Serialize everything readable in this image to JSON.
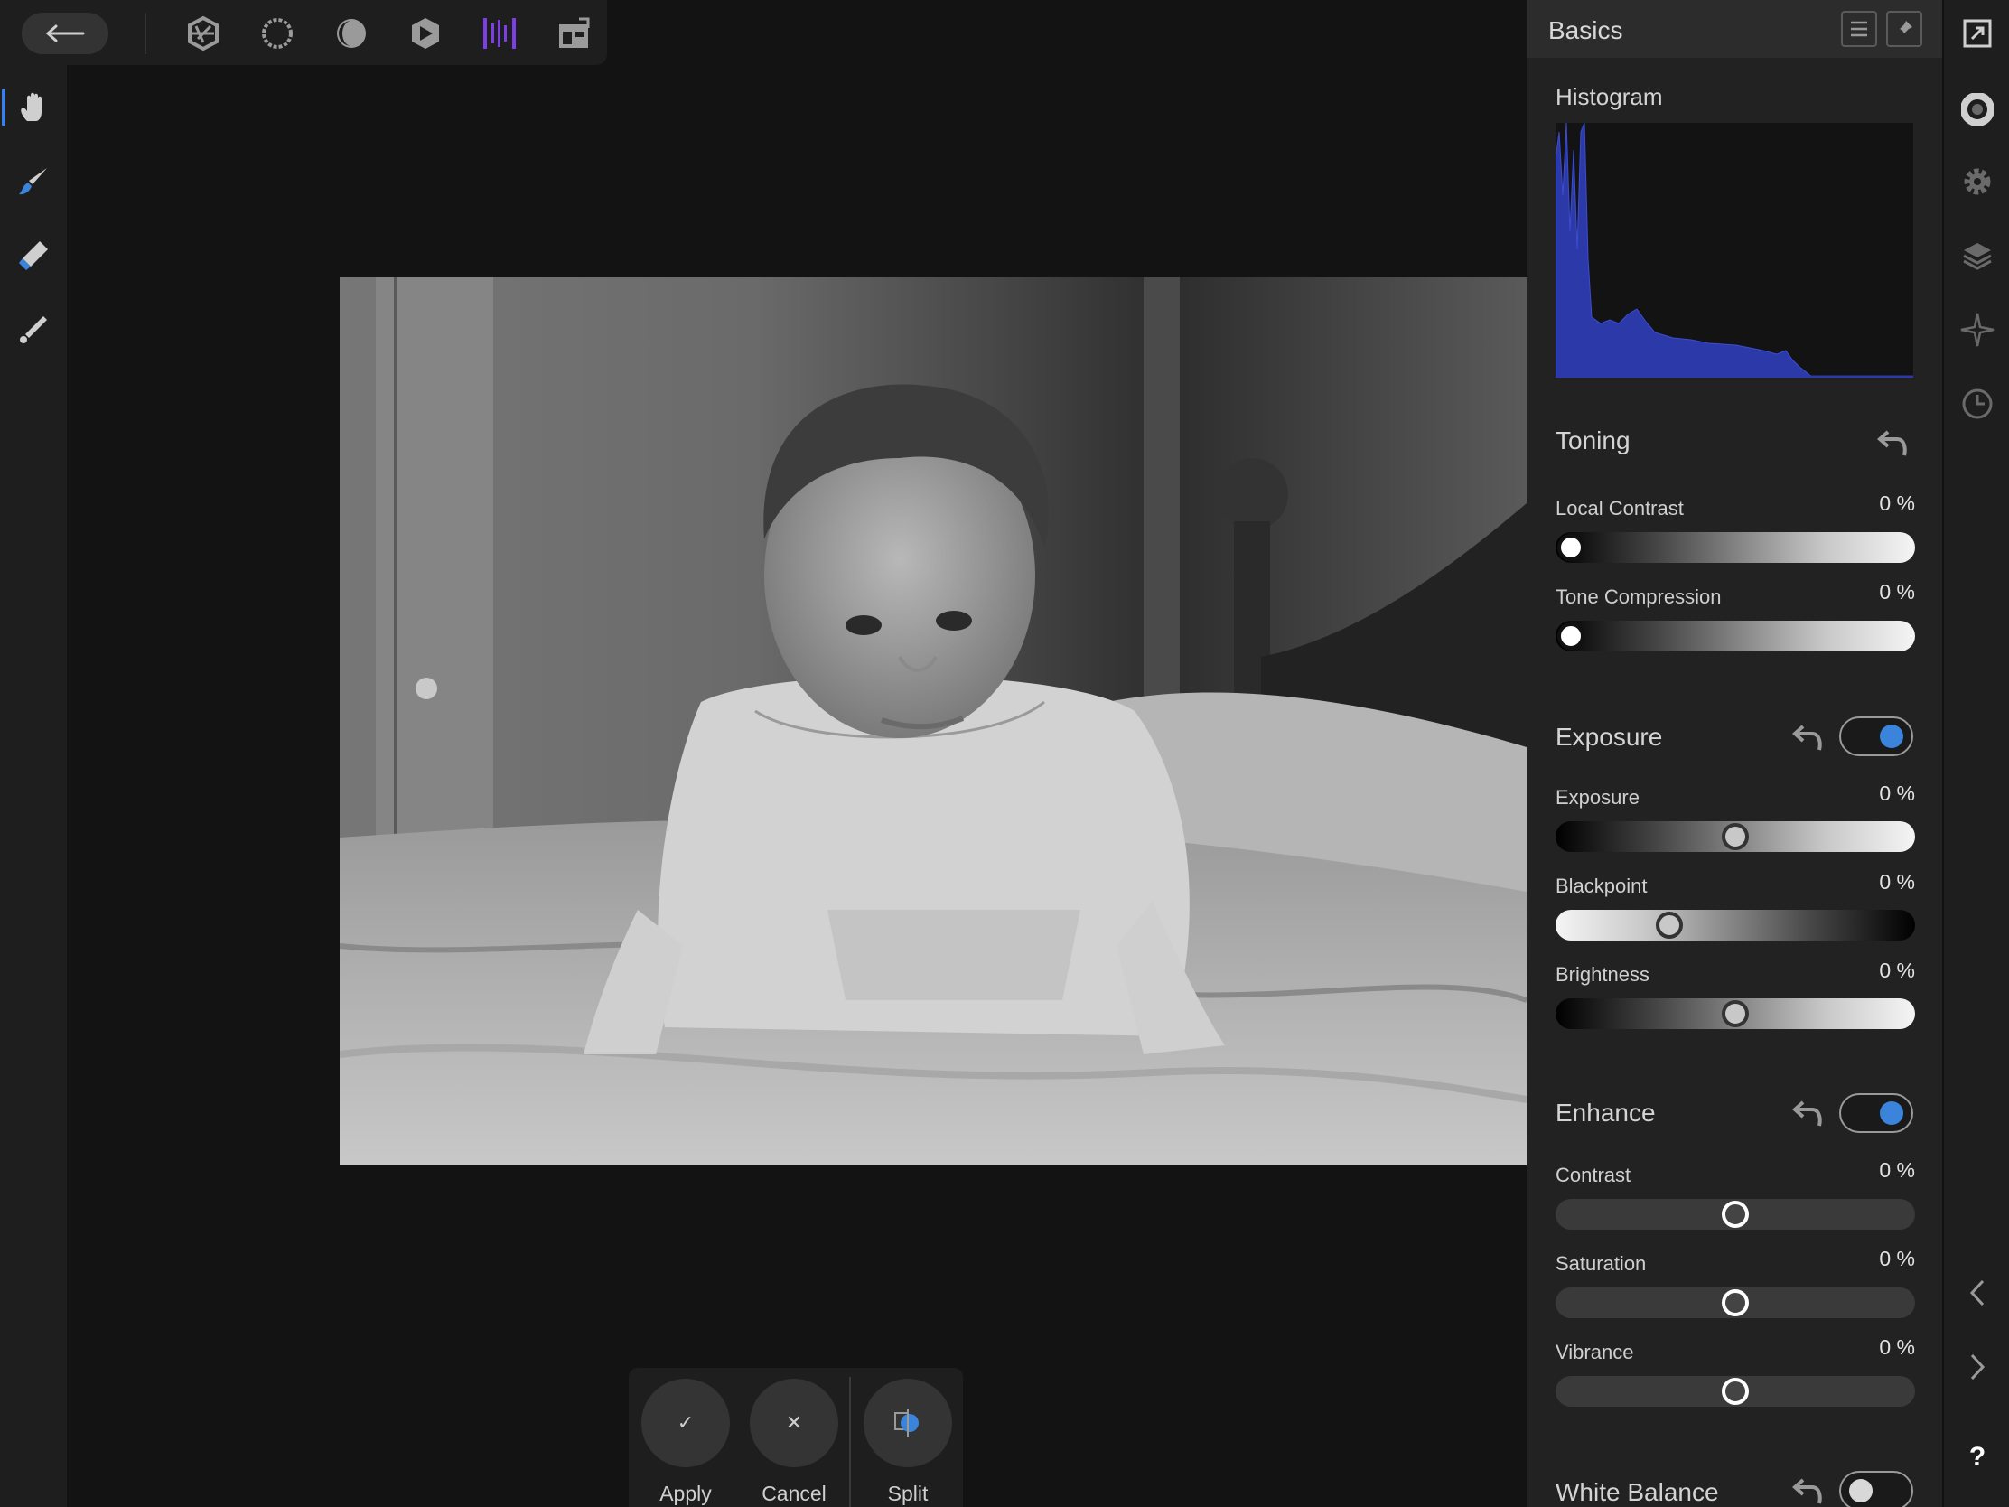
{
  "panel": {
    "title": "Basics",
    "histogram": {
      "title": "Histogram"
    },
    "sections": {
      "toning": {
        "title": "Toning",
        "sliders": {
          "local_contrast": {
            "label": "Local Contrast",
            "value": "0 %",
            "level": 0
          },
          "tone_compression": {
            "label": "Tone Compression",
            "value": "0 %",
            "level": 0
          }
        }
      },
      "exposure": {
        "title": "Exposure",
        "enabled": true,
        "sliders": {
          "exposure": {
            "label": "Exposure",
            "value": "0 %",
            "level": 0.5
          },
          "blackpoint": {
            "label": "Blackpoint",
            "value": "0 %",
            "level": 0.3
          },
          "brightness": {
            "label": "Brightness",
            "value": "0 %",
            "level": 0.5
          }
        }
      },
      "enhance": {
        "title": "Enhance",
        "enabled": true,
        "sliders": {
          "contrast": {
            "label": "Contrast",
            "value": "0 %",
            "level": 0.5
          },
          "saturation": {
            "label": "Saturation",
            "value": "0 %",
            "level": 0.5
          },
          "vibrance": {
            "label": "Vibrance",
            "value": "0 %",
            "level": 0.5
          }
        }
      },
      "white_balance": {
        "title": "White Balance",
        "enabled": false
      }
    }
  },
  "actions": {
    "apply": {
      "label": "Apply",
      "glyph": "✓"
    },
    "cancel": {
      "label": "Cancel",
      "glyph": "✕"
    },
    "split": {
      "label": "Split"
    }
  },
  "colors": {
    "accent": "#3b84dc",
    "persona_active": "#7b3fe4",
    "histogram": "#2b3aa8"
  },
  "icons": {
    "top_bar": [
      "back-arrow-icon",
      "photo-persona-icon",
      "liquify-persona-icon",
      "develop-persona-icon",
      "tone-mapping-persona-icon",
      "export-persona-icon",
      "sliced-persona-icon"
    ],
    "tools": [
      "hand-icon",
      "brush-icon",
      "eraser-icon",
      "gradient-icon"
    ],
    "studio": [
      "canvas-fit-icon",
      "color-icon",
      "settings-icon",
      "layers-icon",
      "navigator-icon",
      "history-icon",
      "chevron-left-icon",
      "chevron-right-icon",
      "help-icon"
    ]
  },
  "help": "?"
}
